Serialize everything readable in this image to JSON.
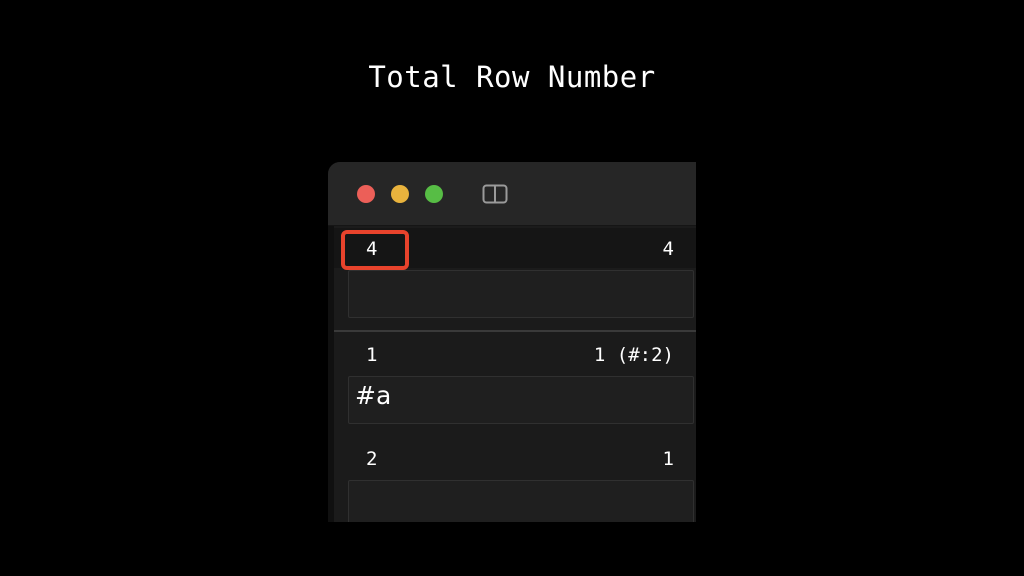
{
  "slide": {
    "title": "Total Row Number"
  },
  "window": {
    "icons": {
      "close": "close-dot",
      "minimize": "minimize-dot",
      "zoom": "zoom-dot",
      "sidebar": "sidebar-toggle-icon"
    },
    "colors": {
      "close": "#ec5f58",
      "minimize": "#e9b33d",
      "zoom": "#57bd45",
      "highlight": "#e8432c"
    }
  },
  "rows": [
    {
      "number": "4",
      "count": "4",
      "field": ""
    },
    {
      "number": "1",
      "count": "1 (#:2)",
      "field": "#a"
    },
    {
      "number": "2",
      "count": "1",
      "field": ""
    }
  ]
}
